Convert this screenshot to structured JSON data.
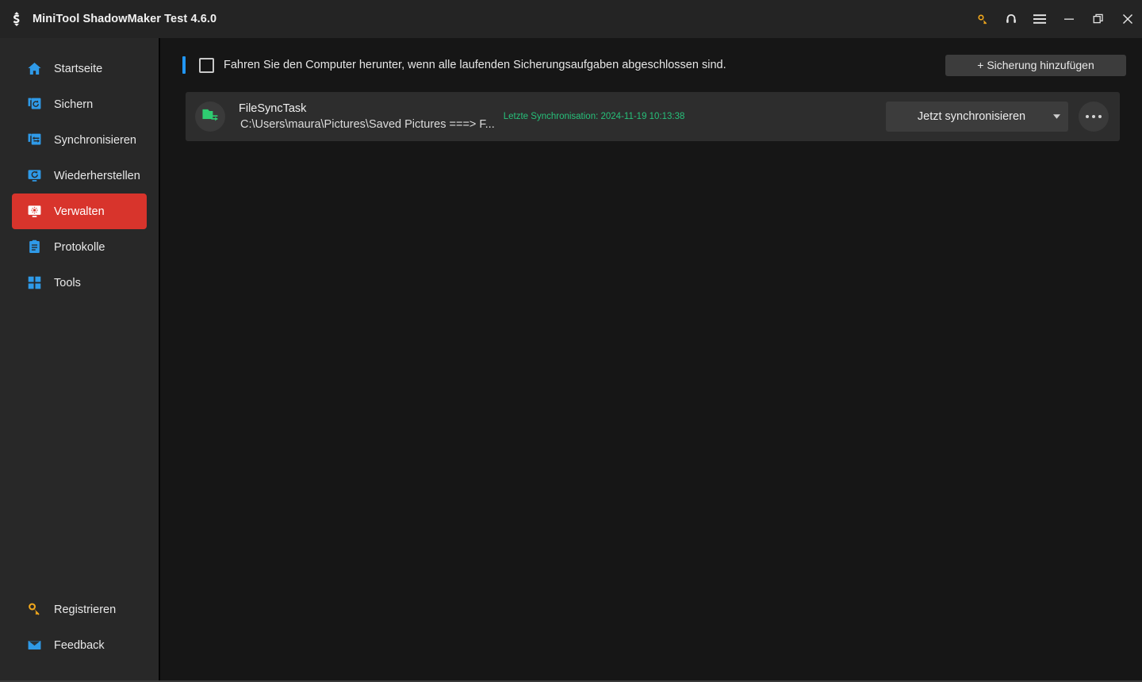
{
  "window": {
    "title": "MiniTool ShadowMaker Test 4.6.0",
    "logo_icon": "shadowmaker-sync-logo",
    "controls": [
      {
        "name": "license-key-button",
        "icon": "key-icon",
        "color": "#f2a81c"
      },
      {
        "name": "support-headset-button",
        "icon": "headset-icon",
        "color": "#e6e6e6"
      },
      {
        "name": "menu-button",
        "icon": "hamburger-menu-icon",
        "color": "#e6e6e6"
      },
      {
        "name": "minimize-button",
        "icon": "minimize-icon",
        "color": "#e6e6e6"
      },
      {
        "name": "restore-button",
        "icon": "restore-icon",
        "color": "#e6e6e6"
      },
      {
        "name": "close-button",
        "icon": "close-icon",
        "color": "#e6e6e6"
      }
    ]
  },
  "colors": {
    "accent_red": "#d8342c",
    "accent_blue": "#2196f3",
    "icon_blue": "#2f9ae8",
    "success_green": "#27c07a",
    "key_orange": "#f2a81c",
    "titlebar_bg": "#242424",
    "sidebar_bg": "#282828",
    "main_bg": "#161616",
    "card_bg": "#2d2d2d"
  },
  "sidebar": {
    "items": [
      {
        "label": "Startseite",
        "icon": "home-icon",
        "active": false
      },
      {
        "label": "Sichern",
        "icon": "backup-icon",
        "active": false
      },
      {
        "label": "Synchronisieren",
        "icon": "sync-icon",
        "active": false
      },
      {
        "label": "Wiederherstellen",
        "icon": "restore-disk-icon",
        "active": false
      },
      {
        "label": "Verwalten",
        "icon": "manage-icon",
        "active": true
      },
      {
        "label": "Protokolle",
        "icon": "logs-icon",
        "active": false
      },
      {
        "label": "Tools",
        "icon": "tools-icon",
        "active": false
      }
    ],
    "bottom_items": [
      {
        "label": "Registrieren",
        "icon": "key-icon"
      },
      {
        "label": "Feedback",
        "icon": "envelope-icon"
      }
    ]
  },
  "main": {
    "shutdown_option": {
      "label": "Fahren Sie den Computer herunter, wenn alle laufenden Sicherungsaufgaben abgeschlossen sind.",
      "checked": false
    },
    "add_backup_label": "+ Sicherung hinzufügen",
    "tasks": [
      {
        "icon": "folder-sync-icon",
        "name": "FileSyncTask",
        "path": "C:\\Users\\maura\\Pictures\\Saved Pictures ===> F...",
        "last_sync": "Letzte Synchronisation: 2024-11-19 10:13:38",
        "action_label": "Jetzt synchronisieren",
        "action_caret": "caret-down-icon",
        "more_label": "more-options-icon"
      }
    ]
  }
}
